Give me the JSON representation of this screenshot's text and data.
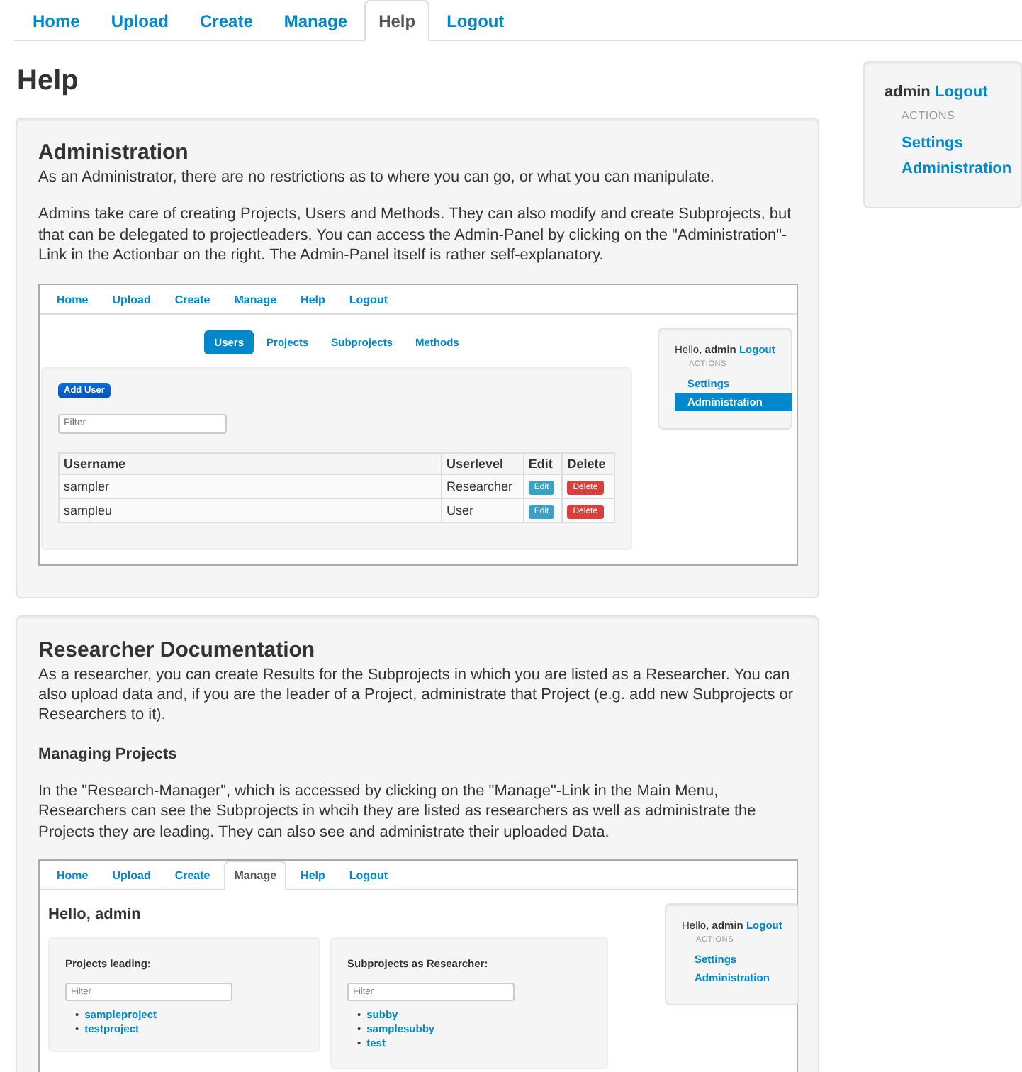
{
  "nav": {
    "tabs": [
      {
        "label": "Home",
        "selected": false
      },
      {
        "label": "Upload",
        "selected": false
      },
      {
        "label": "Create",
        "selected": false
      },
      {
        "label": "Manage",
        "selected": false
      },
      {
        "label": "Help",
        "selected": true
      },
      {
        "label": "Logout",
        "selected": false
      }
    ]
  },
  "title": "Help",
  "sections": [
    {
      "title": "Administration",
      "blocks": [
        {
          "kind": "text",
          "text": "As an Administrator, there are no restrictions as to where you can go, or what you can manipulate."
        },
        {
          "kind": "text",
          "text": "Admins take care of creating Projects, Users and Methods. They can also modify and create Subprojects, but that can be delegated to projectleaders. You can access the Admin-Panel by clicking on the \"Administration\"-Link in the Actionbar on the right. The Admin-Panel itself is rather self-explanatory."
        }
      ],
      "screenshot": {
        "kind": "admin_panel",
        "nav": {
          "tabs": [
            {
              "label": "Home",
              "selected": false
            },
            {
              "label": "Upload",
              "selected": false
            },
            {
              "label": "Create",
              "selected": false
            },
            {
              "label": "Manage",
              "selected": false
            },
            {
              "label": "Help",
              "selected": false
            },
            {
              "label": "Logout",
              "selected": false
            }
          ]
        },
        "subtabs": [
          {
            "label": "Users",
            "selected": true
          },
          {
            "label": "Projects",
            "selected": false
          },
          {
            "label": "Subprojects",
            "selected": false
          },
          {
            "label": "Methods",
            "selected": false
          }
        ],
        "add_button": "Add User",
        "filter": {
          "placeholder": "Filter"
        },
        "table": {
          "columns": [
            "Username",
            "Userlevel",
            "Edit",
            "Delete"
          ],
          "rows": [
            {
              "cells": [
                "sampler",
                "Researcher"
              ],
              "actions": [
                {
                  "kind": "edit",
                  "label": "Edit"
                },
                {
                  "kind": "delete",
                  "label": "Delete"
                }
              ]
            },
            {
              "cells": [
                "sampleu",
                "User"
              ],
              "actions": [
                {
                  "kind": "edit",
                  "label": "Edit"
                },
                {
                  "kind": "delete",
                  "label": "Delete"
                }
              ]
            }
          ]
        },
        "sidebar": {
          "greeting": "Hello,",
          "user": "admin",
          "logout": "Logout",
          "heading": "ACTIONS",
          "items": [
            {
              "label": "Settings",
              "selected": false
            },
            {
              "label": "Administration",
              "selected": true
            }
          ]
        }
      }
    },
    {
      "title": "Researcher Documentation",
      "blocks": [
        {
          "kind": "text",
          "text": "As a researcher, you can create Results for the Subprojects in which you are listed as a Researcher. You can also upload data and, if you are the leader of a Project, administrate that Project (e.g. add new Subprojects or Researchers to it)."
        },
        {
          "kind": "subheading",
          "text": "Managing Projects"
        },
        {
          "kind": "text",
          "text": "In the \"Research-Manager\", which is accessed by clicking on the \"Manage\"-Link in the Main Menu, Researchers can see the Subprojects in whcih they are listed as researchers as well as administrate the Projects they are leading. They can also see and administrate their uploaded Data."
        }
      ],
      "screenshot": {
        "kind": "manager",
        "nav": {
          "tabs": [
            {
              "label": "Home",
              "selected": false
            },
            {
              "label": "Upload",
              "selected": false
            },
            {
              "label": "Create",
              "selected": false
            },
            {
              "label": "Manage",
              "selected": true
            },
            {
              "label": "Help",
              "selected": false
            },
            {
              "label": "Logout",
              "selected": false
            }
          ]
        },
        "heading": "Hello, admin",
        "panels": [
          {
            "title": "Projects leading:",
            "filter": {
              "placeholder": "Filter"
            },
            "items": [
              {
                "bullet": "•",
                "label": "sampleproject"
              },
              {
                "bullet": "•",
                "label": "testproject"
              }
            ]
          },
          {
            "title": "Subprojects as Researcher:",
            "filter": {
              "placeholder": "Filter"
            },
            "items": [
              {
                "bullet": "•",
                "label": "subby"
              },
              {
                "bullet": "•",
                "label": "samplesubby"
              },
              {
                "bullet": "•",
                "label": "test"
              }
            ]
          }
        ],
        "sidebar": {
          "greeting": "Hello,",
          "user": "admin",
          "logout": "Logout",
          "heading": "ACTIONS",
          "items": [
            {
              "label": "Settings",
              "selected": false
            },
            {
              "label": "Administration",
              "selected": false
            }
          ]
        }
      }
    }
  ],
  "sidebar": {
    "user": "admin",
    "logout": "Logout",
    "heading": "ACTIONS",
    "items": [
      {
        "label": "Settings",
        "selected": false
      },
      {
        "label": "Administration",
        "selected": false
      }
    ]
  }
}
